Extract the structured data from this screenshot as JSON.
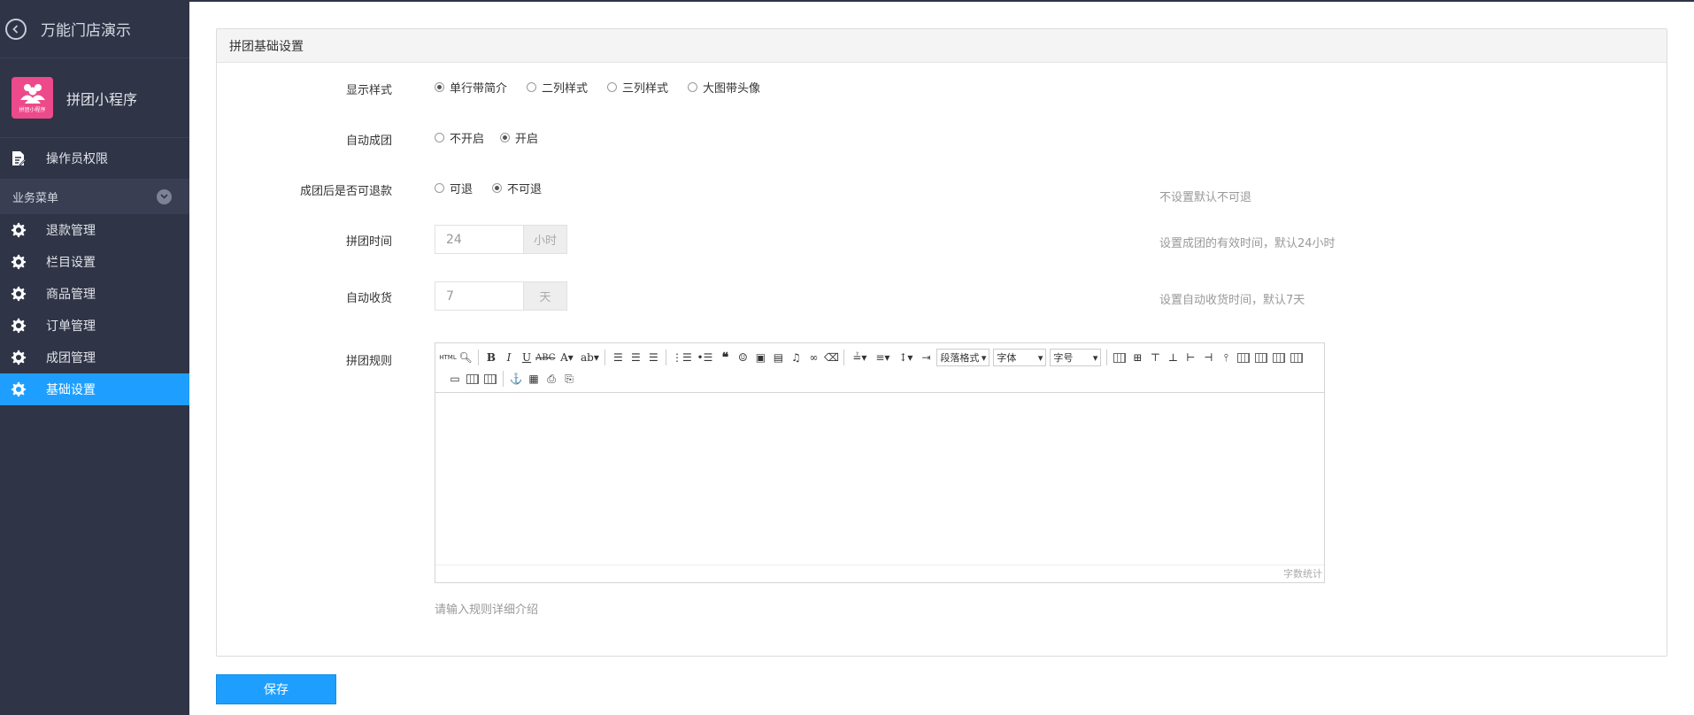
{
  "sidebar": {
    "top_title": "万能门店演示",
    "app_name": "拼团小程序",
    "app_logo_label": "拼团小程序",
    "permissions": "操作员权限",
    "group_label": "业务菜单",
    "items": [
      {
        "label": "退款管理",
        "icon": "gear-icon"
      },
      {
        "label": "栏目设置",
        "icon": "gear-icon"
      },
      {
        "label": "商品管理",
        "icon": "gear-icon"
      },
      {
        "label": "订单管理",
        "icon": "gear-icon"
      },
      {
        "label": "成团管理",
        "icon": "gear-icon"
      },
      {
        "label": "基础设置",
        "icon": "gear-icon",
        "active": true
      }
    ]
  },
  "panel": {
    "title": "拼团基础设置",
    "display_style": {
      "label": "显示样式",
      "options": [
        "单行带简介",
        "二列样式",
        "三列样式",
        "大图带头像"
      ],
      "selected": "单行带简介"
    },
    "auto_group": {
      "label": "自动成团",
      "options": [
        "不开启",
        "开启"
      ],
      "selected": "开启"
    },
    "refund": {
      "label": "成团后是否可退款",
      "options": [
        "可退",
        "不可退"
      ],
      "selected": "不可退",
      "hint": "不设置默认不可退"
    },
    "group_time": {
      "label": "拼团时间",
      "value": "24",
      "unit": "小时",
      "hint": "设置成团的有效时间，默认24小时"
    },
    "auto_receive": {
      "label": "自动收货",
      "value": "7",
      "unit": "天",
      "hint": "设置自动收货时间，默认7天"
    },
    "rules": {
      "label": "拼团规则",
      "toolbar": {
        "html": "HTML",
        "paragraph_select": "段落格式",
        "font_select": "字体",
        "size_select": "字号"
      },
      "word_count": "字数统计",
      "help": "请输入规则详细介绍"
    }
  },
  "save_label": "保存",
  "colors": {
    "sidebar_bg": "#2f3447",
    "accent": "#1e9fff",
    "logo": "#ec4a8b"
  }
}
